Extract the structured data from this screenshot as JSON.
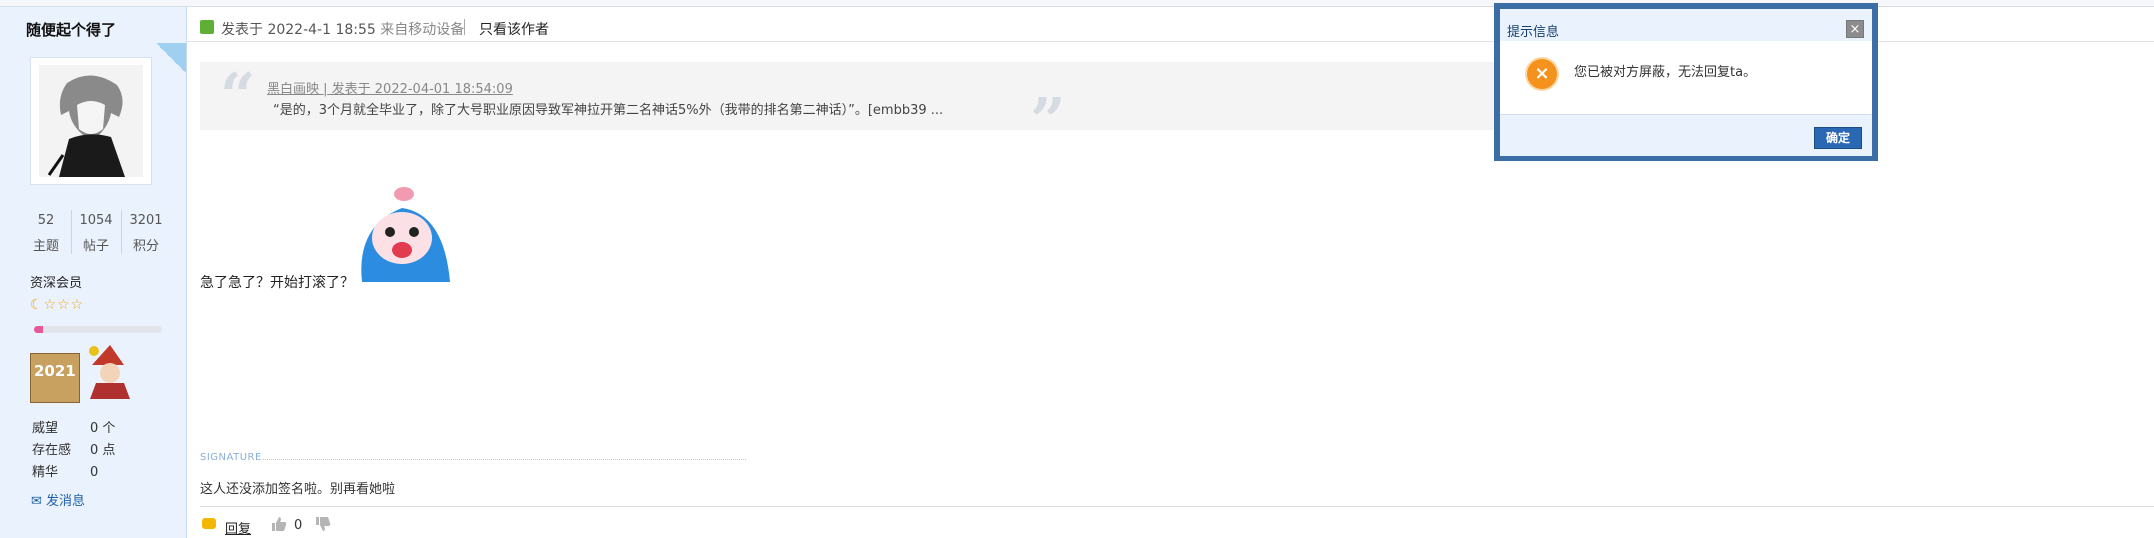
{
  "author": {
    "name": "随便起个得了",
    "stats": [
      {
        "value": "52",
        "label": "主题"
      },
      {
        "value": "1054",
        "label": "帖子"
      },
      {
        "value": "3201",
        "label": "积分"
      }
    ],
    "member_level": "资深会员",
    "stars": "☾☆☆☆",
    "level_progress": 0.07,
    "medal_text": "2021",
    "info": [
      {
        "key": "威望",
        "value": "0 个"
      },
      {
        "key": "存在感",
        "value": "0 点"
      },
      {
        "key": "精华",
        "value": "0"
      }
    ],
    "send_message": "发消息"
  },
  "post": {
    "posted_at": "发表于 2022-4-1 18:55",
    "device": "来自移动设备",
    "only_author": "只看该作者",
    "quote": {
      "meta": "黑白画映 | 发表于 2022-04-01 18:54:09",
      "text": "“是的，3个月就全毕业了，除了大号职业原因导致军神拉开第二名神话5%外（我带的排名第二神话）”。[embb39 ..."
    },
    "body": "急了急了？开始打滚了？",
    "signature_label": "SIGNATURE",
    "signature": "这人还没添加签名啦。别再看她啦",
    "actions": {
      "reply": "回复",
      "like_count": "0"
    }
  },
  "dialog": {
    "title": "提示信息",
    "close": "×",
    "icon": "×",
    "message": "您已被对方屏蔽，无法回复ta。",
    "ok": "确定"
  },
  "colors": {
    "sidebar_bg": "#eaf2fd",
    "dialog_border": "#3a6ea5",
    "ok_button": "#2b68b4",
    "error_icon": "#f5921e"
  }
}
